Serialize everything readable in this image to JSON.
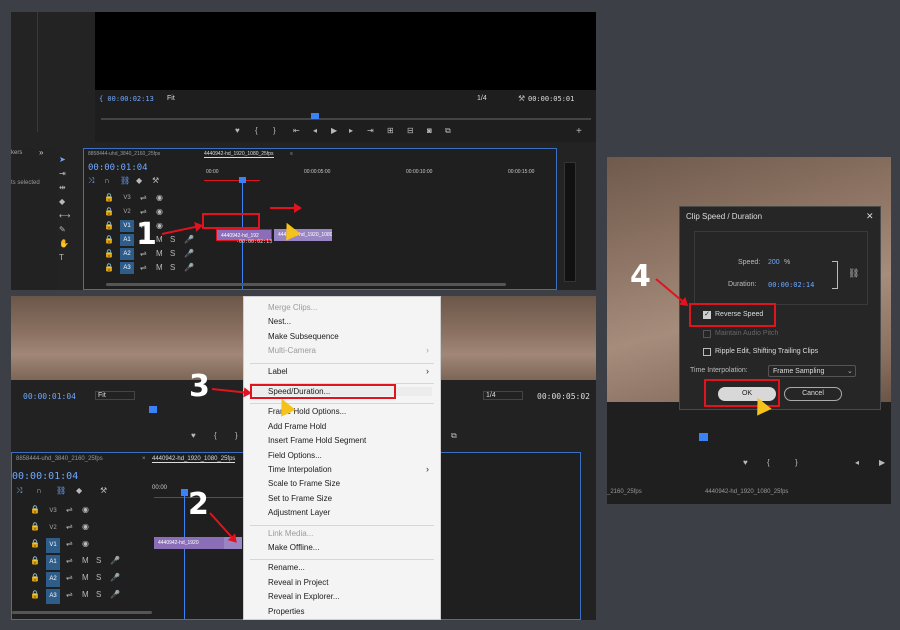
{
  "panel1": {
    "monitor": {
      "timecode_left": "{ 00:00:02:13",
      "fit": "Fit",
      "quarter": "1/4",
      "timecode_right": "00:00:05:01"
    },
    "project": {
      "markers_label": "kers",
      "selected_label": "ts selected",
      "chevron": "»"
    },
    "timeline": {
      "tab_left": "8858444-uhd_3840_2160_25fps",
      "tab_active": "4440942-hd_1920_1080_25fps",
      "tab_close": "≡",
      "timecode": "00:00:01:04",
      "ruler": [
        "00:00",
        "00:00:05:00",
        "00:00:10:00",
        "00:00:15:00"
      ],
      "tracks": [
        "V3",
        "V2",
        "V1",
        "A1",
        "A2",
        "A3"
      ],
      "clip1": "4440942-hd_192",
      "clip2": "4440942-hd_1920_1080",
      "clip_tooltip": "-00:00:02:13"
    }
  },
  "panel2": {
    "timecode": "00:00:01:04",
    "fit": "Fit",
    "quarter": "1/4",
    "timecode_right": "00:00:05:02",
    "tab_left": "8858444-uhd_3840_2160_25fps",
    "tab_active": "4440942-hd_1920_1080_25fps",
    "tab_close": "×",
    "timeline_timecode": "00:00:01:04",
    "ruler0": "00:00",
    "tracks": [
      "V3",
      "V2",
      "V1",
      "A1",
      "A2",
      "A3"
    ],
    "clip1": "4440942-hd_1920",
    "audio_ms": [
      "M",
      "S"
    ]
  },
  "menu": [
    {
      "label": "Merge Clips...",
      "disabled": true
    },
    {
      "label": "Nest...",
      "disabled": false
    },
    {
      "label": "Make Subsequence",
      "disabled": false
    },
    {
      "label": "Multi-Camera",
      "disabled": true,
      "sub": true
    },
    {
      "sep": true
    },
    {
      "label": "Label",
      "disabled": false,
      "sub": true
    },
    {
      "sep": true
    },
    {
      "label": "Speed/Duration...",
      "disabled": false,
      "highlight": true
    },
    {
      "sep": true
    },
    {
      "label": "Frame Hold Options...",
      "disabled": false
    },
    {
      "label": "Add Frame Hold",
      "disabled": false
    },
    {
      "label": "Insert Frame Hold Segment",
      "disabled": false
    },
    {
      "label": "Field Options...",
      "disabled": false
    },
    {
      "label": "Time Interpolation",
      "disabled": false,
      "sub": true
    },
    {
      "label": "Scale to Frame Size",
      "disabled": false
    },
    {
      "label": "Set to Frame Size",
      "disabled": false
    },
    {
      "label": "Adjustment Layer",
      "disabled": false
    },
    {
      "sep": true
    },
    {
      "label": "Link Media...",
      "disabled": true
    },
    {
      "label": "Make Offline...",
      "disabled": false
    },
    {
      "sep": true
    },
    {
      "label": "Rename...",
      "disabled": false
    },
    {
      "label": "Reveal in Project",
      "disabled": false
    },
    {
      "label": "Reveal in Explorer...",
      "disabled": false
    },
    {
      "label": "Properties",
      "disabled": false
    }
  ],
  "dialog": {
    "title": "Clip Speed / Duration",
    "close": "✕",
    "speed_label": "Speed:",
    "speed_value": "200",
    "speed_unit": "%",
    "duration_label": "Duration:",
    "duration_value": "00:00:02:14",
    "reverse_speed": "Reverse Speed",
    "maintain_pitch": "Maintain Audio Pitch",
    "ripple_edit": "Ripple Edit, Shifting Trailing Clips",
    "interp_label": "Time Interpolation:",
    "interp_value": "Frame Sampling",
    "ok": "OK",
    "cancel": "Cancel"
  },
  "panel3_bottom": {
    "tab_left": "_2160_25fps",
    "tab_active": "4440942-hd_1920_1080_25fps"
  },
  "steps": [
    "1",
    "2",
    "3",
    "4"
  ],
  "colors": {
    "accent_blue": "#6fa8ff",
    "highlight_red": "#e0141e",
    "clip_purple": "#8a6fb8",
    "cursor_yellow": "#f4c21a"
  }
}
